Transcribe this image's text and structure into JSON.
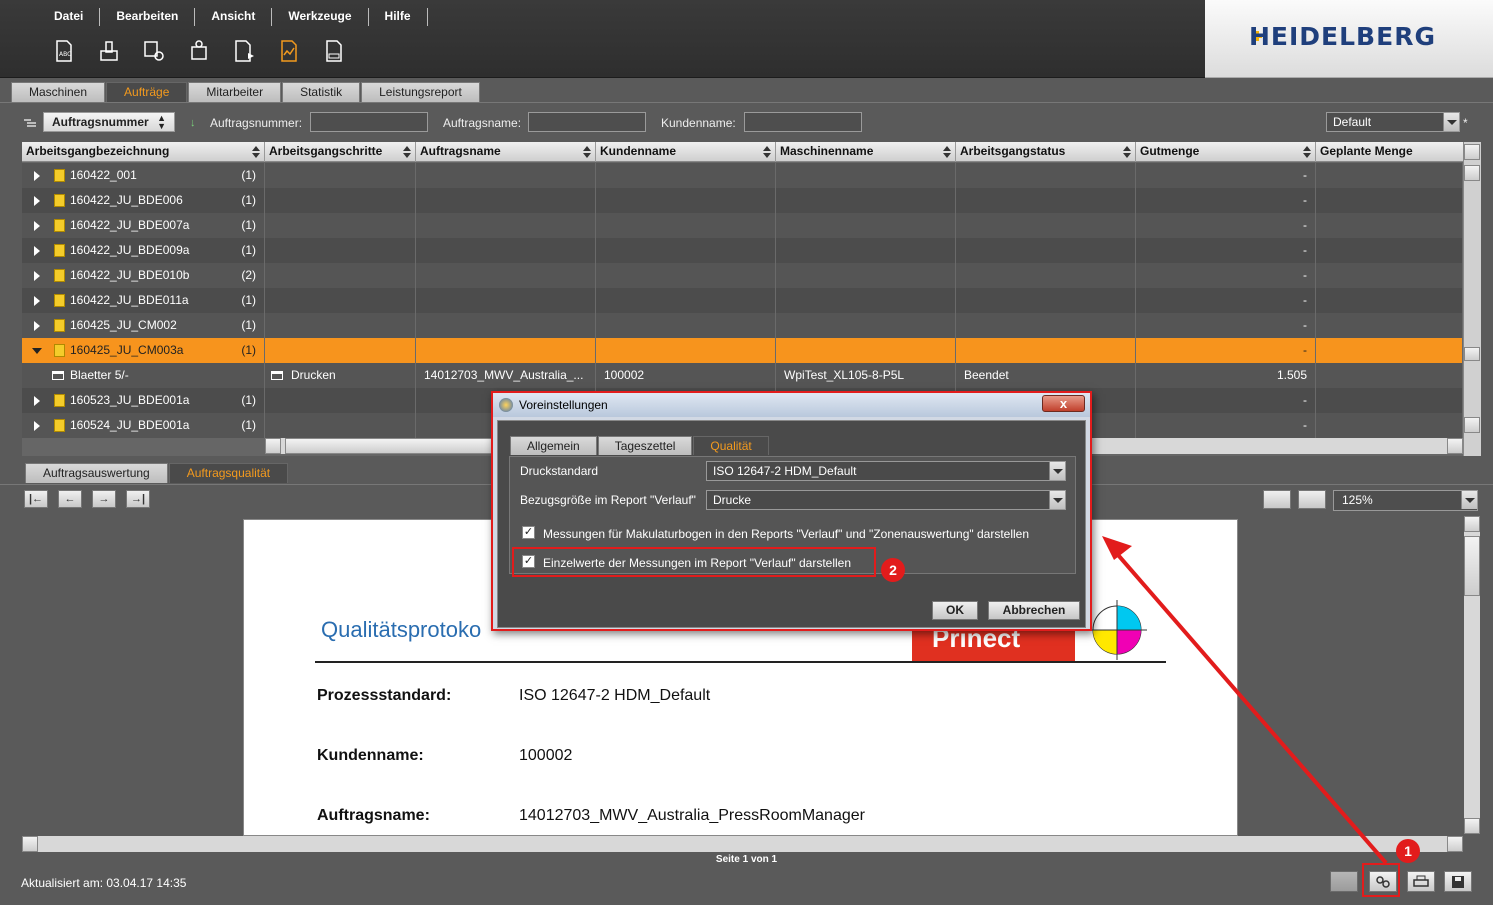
{
  "menu": [
    "Datei",
    "Bearbeiten",
    "Ansicht",
    "Werkzeuge",
    "Hilfe"
  ],
  "toolbar_icons": [
    "job-report-icon",
    "machine-report-icon",
    "machine-settings-icon",
    "shift-report-icon",
    "job-list-icon",
    "quality-report-icon",
    "document-icon"
  ],
  "logo": "HEIDELBERG",
  "main_tabs": [
    "Maschinen",
    "Aufträge",
    "Mitarbeiter",
    "Statistik",
    "Leistungsreport"
  ],
  "filter": {
    "sort_combo": "Auftragsnummer",
    "label_order_no": "Auftragsnummer:",
    "label_order_name": "Auftragsname:",
    "label_customer": "Kundenname:",
    "preset": "Default",
    "preset_marker": "*"
  },
  "grid": {
    "columns": [
      "Arbeitsgangbezeichnung",
      "Arbeitsgangschritte",
      "Auftragsname",
      "Kundenname",
      "Maschinenname",
      "Arbeitsgangstatus",
      "Gutmenge",
      "Geplante Menge"
    ],
    "rows": [
      {
        "name": "160422_001",
        "count": "(1)",
        "good": "-"
      },
      {
        "name": "160422_JU_BDE006",
        "count": "(1)",
        "good": "-"
      },
      {
        "name": "160422_JU_BDE007a",
        "count": "(1)",
        "good": "-"
      },
      {
        "name": "160422_JU_BDE009a",
        "count": "(1)",
        "good": "-"
      },
      {
        "name": "160422_JU_BDE010b",
        "count": "(2)",
        "good": "-"
      },
      {
        "name": "160422_JU_BDE011a",
        "count": "(1)",
        "good": "-"
      },
      {
        "name": "160425_JU_CM002",
        "count": "(1)",
        "good": "-"
      },
      {
        "name": "160425_JU_CM003a",
        "count": "(1)",
        "good": "-"
      },
      {
        "name": "Blaetter  5/-",
        "step": "Drucken",
        "order": "14012703_MWV_Australia_...",
        "customer": "100002",
        "machine": "WpiTest_XL105-8-P5L",
        "status": "Beendet",
        "good": "1.505"
      },
      {
        "name": "160523_JU_BDE001a",
        "count": "(1)",
        "good": "-"
      },
      {
        "name": "160524_JU_BDE001a",
        "count": "(1)",
        "good": "-"
      }
    ]
  },
  "bottom_tabs": [
    "Auftragsauswertung",
    "Auftragsqualität"
  ],
  "zoom": "125%",
  "report": {
    "title": "Qualitätsprotoko",
    "logo_text": "Prinect",
    "fields": [
      {
        "key": "Prozessstandard:",
        "value": "ISO 12647-2 HDM_Default"
      },
      {
        "key": "Kundenname:",
        "value": "100002"
      },
      {
        "key": "Auftragsname:",
        "value": "14012703_MWV_Australia_PressRoomManager"
      }
    ]
  },
  "page_info": "Seite 1 von 1",
  "updated": "Aktualisiert am: 03.04.17 14:35",
  "dialog": {
    "title": "Voreinstellungen",
    "close": "x",
    "tabs": [
      "Allgemein",
      "Tageszettel",
      "Qualität"
    ],
    "print_standard_label": "Druckstandard",
    "print_standard_value": "ISO 12647-2 HDM_Default",
    "reference_label": "Bezugsgröße im Report \"Verlauf\"",
    "reference_value": "Drucke",
    "check1": "Messungen für Makulaturbogen in den Reports \"Verlauf\" und \"Zonenauswertung\" darstellen",
    "check2": "Einzelwerte der Messungen im Report \"Verlauf\" darstellen",
    "ok": "OK",
    "cancel": "Abbrechen"
  },
  "badges": [
    "1",
    "2"
  ],
  "colors": {
    "accent": "#f7941d",
    "highlight": "#e21c1c",
    "brand": "#1f3f7c"
  }
}
